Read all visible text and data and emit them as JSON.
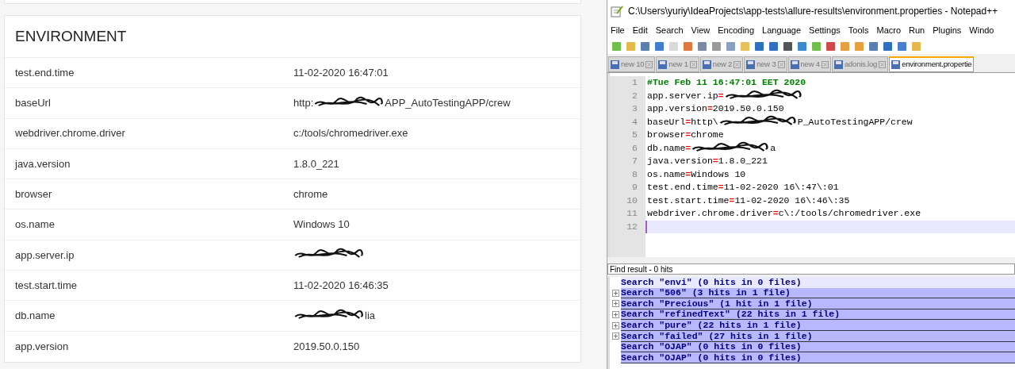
{
  "environment": {
    "title": "ENVIRONMENT",
    "rows": [
      {
        "key": "test.end.time",
        "value": [
          {
            "kind": "text",
            "text": "11-02-2020 16:47:01"
          }
        ]
      },
      {
        "key": "baseUrl",
        "value": [
          {
            "kind": "text",
            "text": "http:"
          },
          {
            "kind": "redaction"
          },
          {
            "kind": "text",
            "text": "APP_AutoTestingAPP/crew"
          }
        ]
      },
      {
        "key": "webdriver.chrome.driver",
        "value": [
          {
            "kind": "text",
            "text": "c:/tools/chromedriver.exe"
          }
        ]
      },
      {
        "key": "java.version",
        "value": [
          {
            "kind": "text",
            "text": "1.8.0_221"
          }
        ]
      },
      {
        "key": "browser",
        "value": [
          {
            "kind": "text",
            "text": "chrome"
          }
        ]
      },
      {
        "key": "os.name",
        "value": [
          {
            "kind": "text",
            "text": "Windows 10"
          }
        ]
      },
      {
        "key": "app.server.ip",
        "value": [
          {
            "kind": "redaction"
          }
        ]
      },
      {
        "key": "test.start.time",
        "value": [
          {
            "kind": "text",
            "text": "11-02-2020 16:46:35"
          }
        ]
      },
      {
        "key": "db.name",
        "value": [
          {
            "kind": "redaction"
          },
          {
            "kind": "text",
            "text": "lia"
          }
        ]
      },
      {
        "key": "app.version",
        "value": [
          {
            "kind": "text",
            "text": "2019.50.0.150"
          }
        ]
      }
    ]
  },
  "notepad": {
    "title": "C:\\Users\\yuriy\\IdeaProjects\\app-tests\\allure-results\\environment.properties - Notepad++",
    "menu": [
      "File",
      "Edit",
      "Search",
      "View",
      "Encoding",
      "Language",
      "Settings",
      "Tools",
      "Macro",
      "Run",
      "Plugins",
      "Windo"
    ],
    "tabs": [
      {
        "label": "new 10",
        "selected": false
      },
      {
        "label": "new 1",
        "selected": false
      },
      {
        "label": "new 2",
        "selected": false
      },
      {
        "label": "new 3",
        "selected": false
      },
      {
        "label": "new 4",
        "selected": false
      },
      {
        "label": "adonis.log",
        "selected": false
      },
      {
        "label": "environment.propertie",
        "selected": true
      }
    ],
    "lines": [
      {
        "number": "1",
        "current": false,
        "parts": [
          {
            "kind": "comment",
            "text": "#Tue Feb 11 16:47:01 EET 2020"
          }
        ]
      },
      {
        "number": "2",
        "current": false,
        "parts": [
          {
            "kind": "key",
            "text": "app.server.ip"
          },
          {
            "kind": "op",
            "text": "="
          },
          {
            "kind": "redaction"
          }
        ]
      },
      {
        "number": "3",
        "current": false,
        "parts": [
          {
            "kind": "key",
            "text": "app.version"
          },
          {
            "kind": "op",
            "text": "="
          },
          {
            "kind": "value",
            "text": "2019.50.0.150"
          }
        ]
      },
      {
        "number": "4",
        "current": false,
        "parts": [
          {
            "kind": "key",
            "text": "baseUrl"
          },
          {
            "kind": "op",
            "text": "="
          },
          {
            "kind": "value",
            "text": "http\\"
          },
          {
            "kind": "redaction"
          },
          {
            "kind": "value",
            "text": "P_AutoTestingAPP/crew"
          }
        ]
      },
      {
        "number": "5",
        "current": false,
        "parts": [
          {
            "kind": "key",
            "text": "browser"
          },
          {
            "kind": "op",
            "text": "="
          },
          {
            "kind": "value",
            "text": "chrome"
          }
        ]
      },
      {
        "number": "6",
        "current": false,
        "parts": [
          {
            "kind": "key",
            "text": "db.name"
          },
          {
            "kind": "op",
            "text": "="
          },
          {
            "kind": "redaction"
          },
          {
            "kind": "value",
            "text": "a"
          }
        ]
      },
      {
        "number": "7",
        "current": false,
        "parts": [
          {
            "kind": "key",
            "text": "java.version"
          },
          {
            "kind": "op",
            "text": "="
          },
          {
            "kind": "value",
            "text": "1.8.0_221"
          }
        ]
      },
      {
        "number": "8",
        "current": false,
        "parts": [
          {
            "kind": "key",
            "text": "os.name"
          },
          {
            "kind": "op",
            "text": "="
          },
          {
            "kind": "value",
            "text": "Windows 10"
          }
        ]
      },
      {
        "number": "9",
        "current": false,
        "parts": [
          {
            "kind": "key",
            "text": "test.end.time"
          },
          {
            "kind": "op",
            "text": "="
          },
          {
            "kind": "value",
            "text": "11-02-2020 16\\:47\\:01"
          }
        ]
      },
      {
        "number": "10",
        "current": false,
        "parts": [
          {
            "kind": "key",
            "text": "test.start.time"
          },
          {
            "kind": "op",
            "text": "="
          },
          {
            "kind": "value",
            "text": "11-02-2020 16\\:46\\:35"
          }
        ]
      },
      {
        "number": "11",
        "current": false,
        "parts": [
          {
            "kind": "key",
            "text": "webdriver.chrome.driver"
          },
          {
            "kind": "op",
            "text": "="
          },
          {
            "kind": "value",
            "text": "c\\:/tools/chromedriver.exe"
          }
        ]
      },
      {
        "number": "12",
        "current": true
      }
    ],
    "find_title": "Find result - 0 hits",
    "results": [
      {
        "text": "Search \"envi\" (0 hits in 0 files)",
        "expandable": false,
        "selected": false
      },
      {
        "text": "Search \"506\" (3 hits in 1 file)",
        "expandable": true,
        "selected": true
      },
      {
        "text": "Search \"Precious\" (1 hit in 1 file)",
        "expandable": true,
        "selected": true
      },
      {
        "text": "Search \"refinedText\" (22 hits in 1 file)",
        "expandable": true,
        "selected": true
      },
      {
        "text": "Search \"pure\" (22 hits in 1 file)",
        "expandable": true,
        "selected": true
      },
      {
        "text": "Search \"failed\" (27 hits in 1 file)",
        "expandable": true,
        "selected": true
      },
      {
        "text": "Search \"OJAP\" (0 hits in 0 files)",
        "expandable": false,
        "selected": true
      },
      {
        "text": "Search \"OJAP\" (0 hits in 0 files)",
        "expandable": false,
        "selected": true
      }
    ]
  }
}
